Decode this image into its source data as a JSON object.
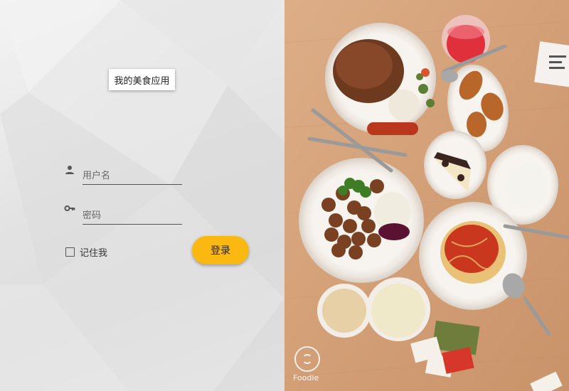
{
  "app": {
    "title": "我的美食应用"
  },
  "login": {
    "username_placeholder": "用户名",
    "password_placeholder": "密码",
    "remember_label": "记住我",
    "remember_checked": false,
    "submit_label": "登录"
  },
  "photo": {
    "watermark": "Foodie"
  },
  "colors": {
    "accent": "#fbb810",
    "panel": "#e3e3e3",
    "table": "#d4a47c"
  },
  "icons": {
    "user": "person-icon",
    "password": "key-icon",
    "camera": "camera-ring-icon"
  }
}
